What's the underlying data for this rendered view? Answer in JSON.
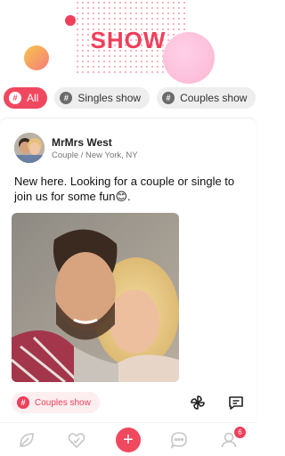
{
  "header": {
    "title": "SHOW"
  },
  "filters": [
    {
      "label": "All",
      "active": true
    },
    {
      "label": "Singles show",
      "active": false
    },
    {
      "label": "Couples show",
      "active": false
    }
  ],
  "post": {
    "user_name": "MrMrs West",
    "user_meta": "Couple / New York, NY",
    "text": "New here. Looking for a couple or single to join us for some fun😊.",
    "tag": "Couples show",
    "photo": "couple-selfie-photo",
    "actions": [
      "pinwheel-icon",
      "comment-icon"
    ]
  },
  "bottom_nav": {
    "items": [
      "discover-icon",
      "likes-icon",
      "add-icon",
      "chat-icon",
      "profile-icon"
    ],
    "badge": "6"
  },
  "colors": {
    "accent": "#ef3f5b",
    "chip_bg": "#eeeeef",
    "tag_bg": "#fdeef0"
  }
}
